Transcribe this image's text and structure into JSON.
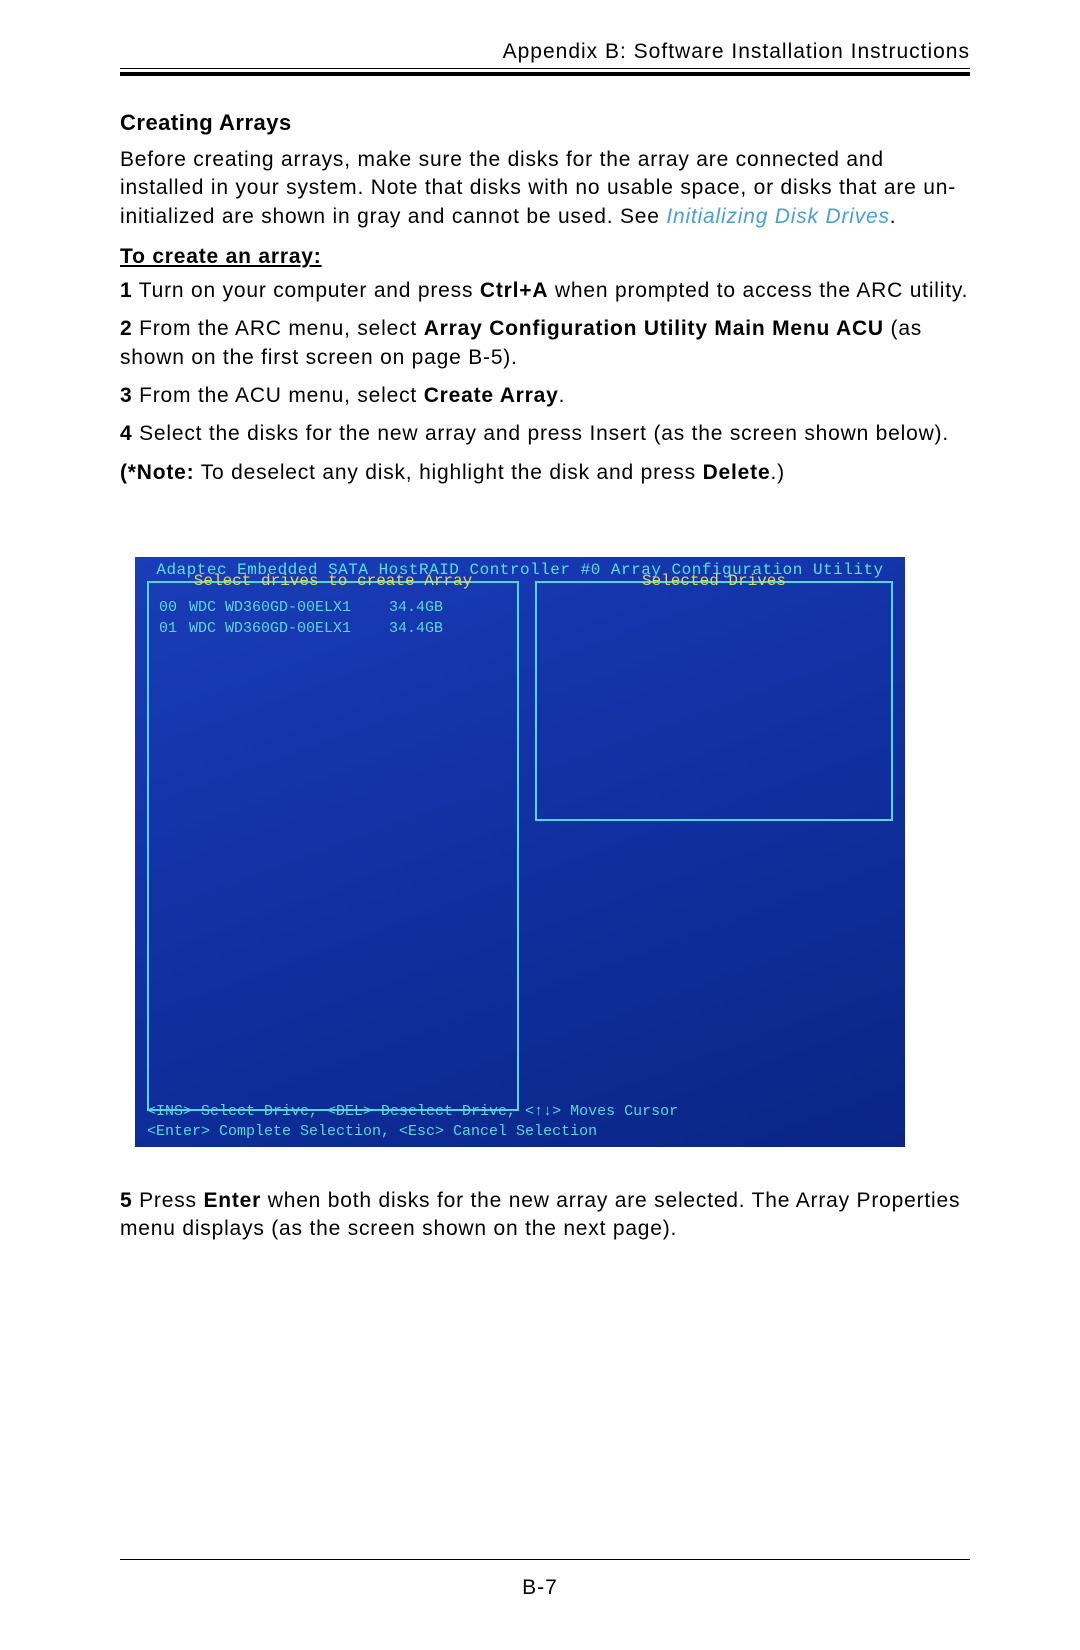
{
  "header": {
    "title": "Appendix B: Software Installation Instructions"
  },
  "section": {
    "title": "Creating Arrays"
  },
  "intro": {
    "text_before_link": "Before creating arrays, make sure the disks for the array are connected and installed in your system. Note that disks with no usable space, or disks that are un-initialized are shown in gray and cannot be used. See ",
    "link_text": "Initializing Disk Drives",
    "text_after_link": "."
  },
  "subheading": "To create an array:",
  "steps": {
    "s1": {
      "num": "1",
      "a": " Turn on your computer and press ",
      "b1": "Ctrl+A",
      "c": " when prompted to access the ARC utility."
    },
    "s2": {
      "num": "2",
      "a": " From the ARC menu, select ",
      "b1": "Array Configuration Utility Main Menu ACU",
      "c": " (as shown on the first screen on page B-5)."
    },
    "s3": {
      "num": "3",
      "a": " From the ACU menu, select ",
      "b1": "Create Array",
      "c": "."
    },
    "s4": {
      "num": "4",
      "a": " Select the disks for the new array and press Insert (as the screen shown below)."
    },
    "note": {
      "label": "(*Note:",
      "a": " To deselect any disk, highlight the disk and press ",
      "b1": "Delete",
      "c": ".)"
    },
    "s5": {
      "num": "5",
      "a": " Press ",
      "b1": "Enter",
      "c": " when both disks for the new array are selected. The Array Properties menu displays (as the screen shown on the next page)."
    }
  },
  "screenshot": {
    "title": "Adaptec Embedded SATA HostRAID Controller #0 Array Configuration Utility",
    "left_label": "Select drives to create Array",
    "right_label": "Selected Drives",
    "drives": [
      {
        "id": "00",
        "model": "WDC WD360GD-00ELX1",
        "size": "34.4GB"
      },
      {
        "id": "01",
        "model": "WDC WD360GD-00ELX1",
        "size": "34.4GB"
      }
    ],
    "footer_line1": "<INS> Select Drive, <DEL> Deselect Drive, <↑↓> Moves Cursor",
    "footer_line2": "<Enter> Complete Selection, <Esc> Cancel Selection"
  },
  "page_number": "B-7"
}
